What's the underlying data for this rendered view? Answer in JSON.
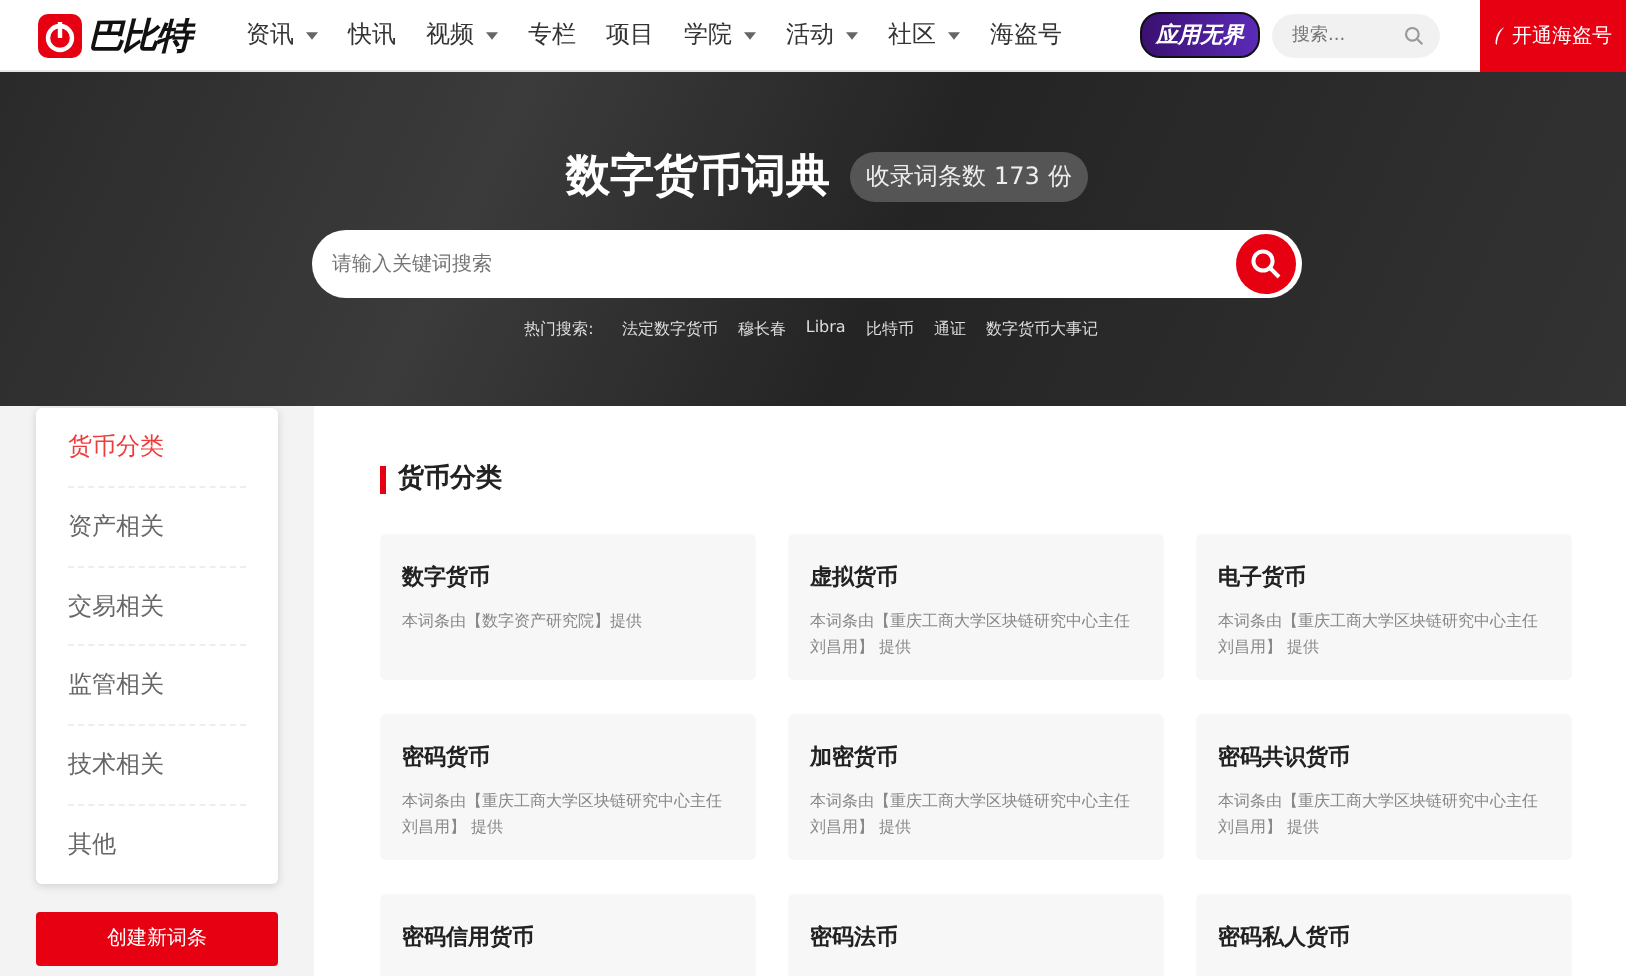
{
  "header": {
    "logo": "巴比特",
    "nav": [
      {
        "label": "资讯",
        "dropdown": true
      },
      {
        "label": "快讯",
        "dropdown": false
      },
      {
        "label": "视频",
        "dropdown": true
      },
      {
        "label": "专栏",
        "dropdown": false
      },
      {
        "label": "项目",
        "dropdown": false
      },
      {
        "label": "学院",
        "dropdown": true
      },
      {
        "label": "活动",
        "dropdown": true
      },
      {
        "label": "社区",
        "dropdown": true
      },
      {
        "label": "海盗号",
        "dropdown": false
      }
    ],
    "promo_badge": "应用无界",
    "search": {
      "placeholder": "搜索..."
    },
    "cta": "开通海盗号"
  },
  "hero": {
    "title": "数字货币词典",
    "count_badge": "收录词条数 173 份",
    "search": {
      "placeholder": "请输入关键词搜索"
    },
    "hot_label": "热门搜索:",
    "hot_terms": [
      "法定数字货币",
      "穆长春",
      "Libra",
      "比特币",
      "通证",
      "数字货币大事记"
    ]
  },
  "sidebar": {
    "items": [
      {
        "label": "货币分类",
        "selected": true
      },
      {
        "label": "资产相关",
        "selected": false
      },
      {
        "label": "交易相关",
        "selected": false
      },
      {
        "label": "监管相关",
        "selected": false
      },
      {
        "label": "技术相关",
        "selected": false
      },
      {
        "label": "其他",
        "selected": false
      }
    ],
    "create_button": "创建新词条"
  },
  "section": {
    "title": "货币分类",
    "cards": [
      {
        "title": "数字货币",
        "source": "本词条由【数字资产研究院】提供"
      },
      {
        "title": "虚拟货币",
        "source": "本词条由【重庆工商大学区块链研究中心主任刘昌用】 提供"
      },
      {
        "title": "电子货币",
        "source": "本词条由【重庆工商大学区块链研究中心主任刘昌用】 提供"
      },
      {
        "title": "密码货币",
        "source": "本词条由【重庆工商大学区块链研究中心主任刘昌用】 提供"
      },
      {
        "title": "加密货币",
        "source": "本词条由【重庆工商大学区块链研究中心主任刘昌用】 提供"
      },
      {
        "title": "密码共识货币",
        "source": "本词条由【重庆工商大学区块链研究中心主任刘昌用】 提供"
      },
      {
        "title": "密码信用货币"
      },
      {
        "title": "密码法币"
      },
      {
        "title": "密码私人货币"
      }
    ]
  }
}
